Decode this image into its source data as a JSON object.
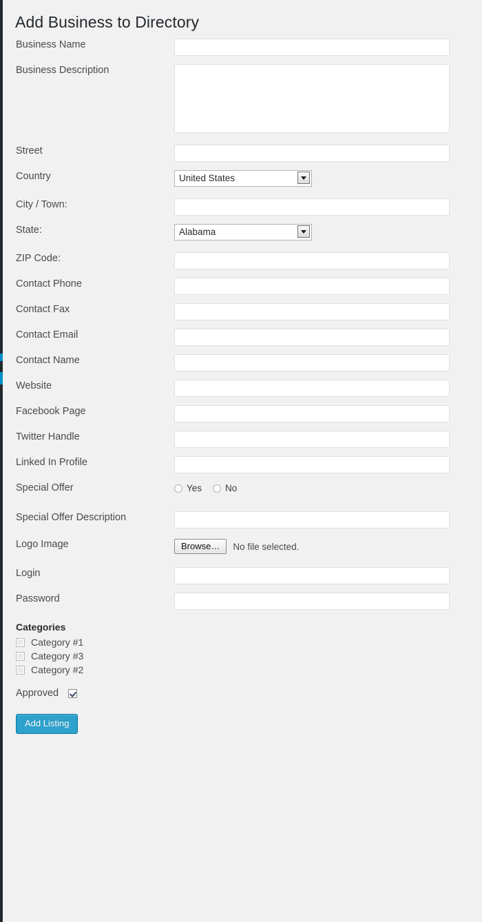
{
  "page": {
    "title": "Add Business to Directory"
  },
  "theme": {
    "background": "#f1f1f1",
    "rail": "#23282d",
    "rail_accent": "#0090c8",
    "primary_button": "#2ea2cc",
    "primary_button_border": "#0074a2",
    "input_border": "#dfdfdf",
    "label_text": "#4a4a4a"
  },
  "fields": {
    "business_name": {
      "label": "Business Name",
      "value": "",
      "placeholder": ""
    },
    "business_description": {
      "label": "Business Description",
      "value": "",
      "placeholder": ""
    },
    "street": {
      "label": "Street",
      "value": "",
      "placeholder": ""
    },
    "country": {
      "label": "Country",
      "value": "United States"
    },
    "city": {
      "label": "City / Town:",
      "value": "",
      "placeholder": ""
    },
    "state": {
      "label": "State:",
      "value": "Alabama"
    },
    "zip": {
      "label": "ZIP Code:",
      "value": "",
      "placeholder": ""
    },
    "contact_phone": {
      "label": "Contact Phone",
      "value": "",
      "placeholder": ""
    },
    "contact_fax": {
      "label": "Contact Fax",
      "value": "",
      "placeholder": ""
    },
    "contact_email": {
      "label": "Contact Email",
      "value": "",
      "placeholder": ""
    },
    "contact_name": {
      "label": "Contact Name",
      "value": "",
      "placeholder": ""
    },
    "website": {
      "label": "Website",
      "value": "",
      "placeholder": ""
    },
    "facebook": {
      "label": "Facebook Page",
      "value": "",
      "placeholder": ""
    },
    "twitter": {
      "label": "Twitter Handle",
      "value": "",
      "placeholder": ""
    },
    "linkedin": {
      "label": "Linked In Profile",
      "value": "",
      "placeholder": ""
    },
    "special_offer": {
      "label": "Special Offer",
      "options": [
        {
          "label": "Yes",
          "value": "yes",
          "selected": false
        },
        {
          "label": "No",
          "value": "no",
          "selected": false
        }
      ]
    },
    "special_offer_description": {
      "label": "Special Offer Description",
      "value": "",
      "placeholder": ""
    },
    "logo_image": {
      "label": "Logo Image",
      "button_label": "Browse…",
      "status": "No file selected."
    },
    "login": {
      "label": "Login",
      "value": "",
      "placeholder": ""
    },
    "password": {
      "label": "Password",
      "value": "",
      "placeholder": ""
    }
  },
  "categories": {
    "heading": "Categories",
    "items": [
      {
        "label": "Category #1",
        "checked": false
      },
      {
        "label": "Category #3",
        "checked": false
      },
      {
        "label": "Category #2",
        "checked": false
      }
    ]
  },
  "approved": {
    "label": "Approved",
    "checked": true
  },
  "submit": {
    "label": "Add Listing"
  }
}
